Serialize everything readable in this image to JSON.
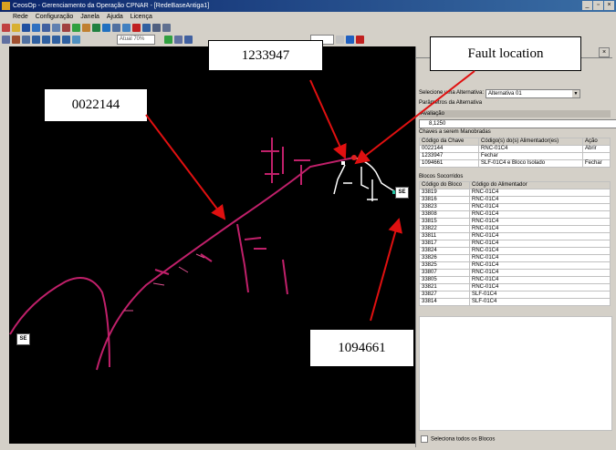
{
  "window": {
    "title": "CeosOp - Gerenciamento da Operação CPNAR - [RedeBaseAntiga1]"
  },
  "menu": [
    "Rede",
    "Configuração",
    "Janela",
    "Ajuda",
    "Licença"
  ],
  "toolbar": {
    "zoom_value": "Atual 70%"
  },
  "map": {
    "se_label": "SE"
  },
  "callouts": {
    "feeder": "0022144",
    "switch_1": "1233947",
    "fault": "Fault location",
    "switch_2": "1094661"
  },
  "panel": {
    "select_label": "Selecione uma Alternativa:",
    "select_value": "Alternativa 01",
    "params_header": "Parâmetros da Alternativa",
    "eval_label": "Avaliação",
    "eval_value": "8,1250",
    "switches_header": "Chaves a serem Manobradas",
    "switch_columns": [
      "Código da Chave",
      "Código(s) do(s) Alimentador(es)",
      "Ação"
    ],
    "switch_rows": [
      [
        "0022144",
        "RNC-01C4",
        "Abrir"
      ],
      [
        "1233947",
        "Fechar",
        ""
      ],
      [
        "1094661",
        "SLF-01C4 e Bloco Isolado",
        "Fechar"
      ]
    ],
    "blocks_header": "Blocos Socorridos",
    "block_columns": [
      "Código do Bloco",
      "Código do Alimentador"
    ],
    "block_rows": [
      [
        "33819",
        "RNC-01C4"
      ],
      [
        "33816",
        "RNC-01C4"
      ],
      [
        "33823",
        "RNC-01C4"
      ],
      [
        "33808",
        "RNC-01C4"
      ],
      [
        "33815",
        "RNC-01C4"
      ],
      [
        "33822",
        "RNC-01C4"
      ],
      [
        "33811",
        "RNC-01C4"
      ],
      [
        "33817",
        "RNC-01C4"
      ],
      [
        "33824",
        "RNC-01C4"
      ],
      [
        "33826",
        "RNC-01C4"
      ],
      [
        "33825",
        "RNC-01C4"
      ],
      [
        "33807",
        "RNC-01C4"
      ],
      [
        "33805",
        "RNC-01C4"
      ],
      [
        "33821",
        "RNC-01C4"
      ],
      [
        "33827",
        "SLF-01C4"
      ],
      [
        "33814",
        "SLF-01C4"
      ]
    ],
    "select_all": "Seleciona todos os Blocos"
  }
}
